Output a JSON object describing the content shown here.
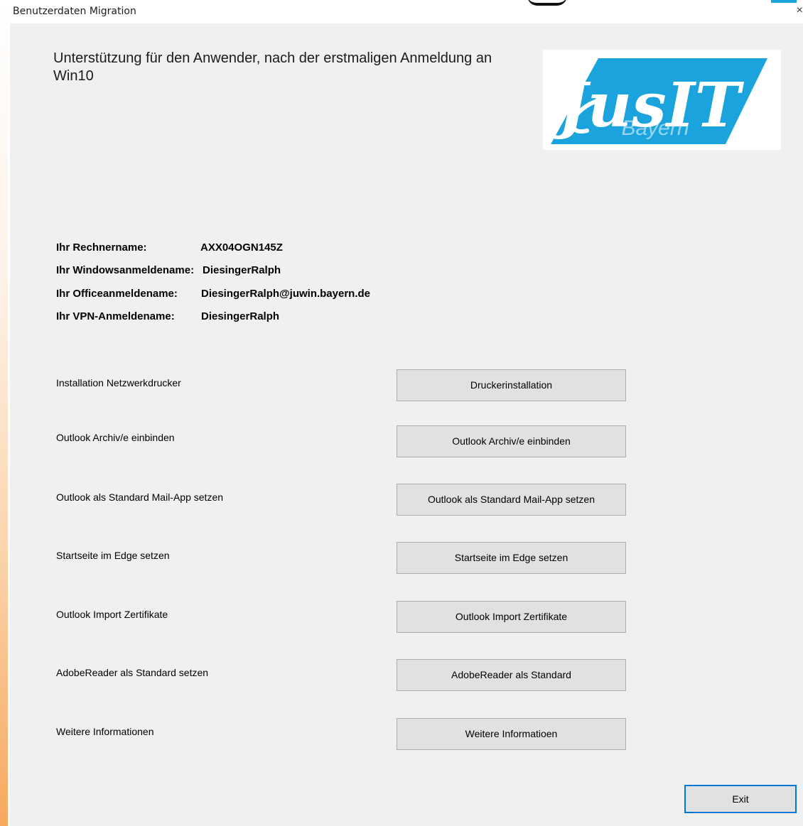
{
  "window": {
    "title": "Benutzerdaten Migration",
    "close_glyph": "×"
  },
  "heading": "Unterstützung für den Anwender, nach der erstmaligen Anmeldung an Win10",
  "logo": {
    "text": "JusIT",
    "subtext": "Bayern",
    "color": "#1aa3dc"
  },
  "info": [
    {
      "label": "Ihr Rechnername:",
      "value": "AXX04OGN145Z"
    },
    {
      "label": "Ihr Windowsanmeldename:",
      "value": "DiesingerRalph"
    },
    {
      "label": "Ihr Officeanmeldename:",
      "value": "DiesingerRalph@juwin.bayern.de"
    },
    {
      "label": "Ihr VPN-Anmeldename:",
      "value": "DiesingerRalph"
    }
  ],
  "actions": [
    {
      "label": "Installation Netzwerkdrucker",
      "button": "Druckerinstallation"
    },
    {
      "label": "Outlook Archiv/e einbinden",
      "button": "Outlook Archiv/e einbinden"
    },
    {
      "label": "Outlook als Standard Mail-App setzen",
      "button": "Outlook als Standard Mail-App setzen"
    },
    {
      "label": "Startseite im Edge setzen",
      "button": "Startseite im Edge setzen"
    },
    {
      "label": "Outlook Import Zertifikate",
      "button": "Outlook Import Zertifikate"
    },
    {
      "label": "AdobeReader als Standard setzen",
      "button": "AdobeReader als Standard"
    },
    {
      "label": "Weitere Informationen",
      "button": "Weitere Informatioen"
    }
  ],
  "exit_label": "Exit"
}
